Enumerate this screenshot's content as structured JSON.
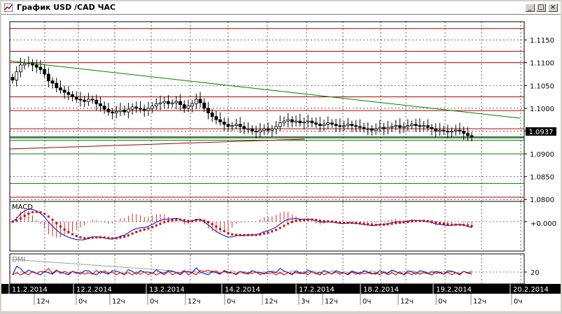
{
  "window": {
    "title": "График USD /CAD  ЧАС",
    "buttons": [
      "_",
      "□",
      "×"
    ]
  },
  "price_axis": {
    "labels": [
      "1.1150",
      "1.1100",
      "1.1050",
      "1.1000",
      "1.0950",
      "1.0900",
      "1.0850",
      "1.0800"
    ],
    "current_price": "1.0937"
  },
  "macd": {
    "label": "MACD",
    "zero_label": "+0.000"
  },
  "dmi": {
    "label": "DMI",
    "level_label": "20"
  },
  "dates": [
    "11.2.2014",
    "12.2.2014",
    "13.2.2014",
    "14.2.2014",
    "17.2.2014",
    "18.2.2014",
    "19.2.2014",
    "20.2.2014"
  ],
  "hour_labels": [
    "12ч",
    "0ч",
    "12ч",
    "0ч",
    "12ч",
    "0ч",
    "12ч",
    "3ч",
    "12ч",
    "0ч",
    "12ч",
    "0ч",
    "12ч",
    "0ч"
  ],
  "colors": {
    "hline": "#b00000",
    "trend_down": "#008000",
    "trend_up": "#a00000",
    "support": "#008000",
    "macd_line": "#0000c0",
    "macd_signal": "#d00000",
    "macd_hist": "#d00000",
    "dmi_plus": "#0000c0",
    "dmi_minus": "#d00000",
    "adx": "#a0a0a0"
  },
  "chart_data": {
    "type": "candlestick",
    "timeframe": "hourly",
    "instrument": "USD/CAD",
    "ylim": [
      1.0785,
      1.119
    ],
    "dates": [
      "11.2.2014",
      "12.2.2014",
      "13.2.2014",
      "14.2.2014",
      "17.2.2014",
      "18.2.2014",
      "19.2.2014",
      "20.2.2014"
    ],
    "close_profile": [
      1.1062,
      1.108,
      1.1095,
      1.1098,
      1.11,
      1.1095,
      1.109,
      1.1085,
      1.1075,
      1.106,
      1.1055,
      1.1045,
      1.104,
      1.1035,
      1.103,
      1.1025,
      1.102,
      1.1018,
      1.1015,
      1.102,
      1.1018,
      1.101,
      1.1005,
      1.0998,
      1.0992,
      1.099,
      1.0993,
      1.0996,
      1.0992,
      1.0998,
      1.1003,
      1.1,
      1.0998,
      1.0995,
      1.1,
      1.1005,
      1.101,
      1.1012,
      1.1015,
      1.101,
      1.1012,
      1.1015,
      1.1008,
      1.1,
      1.1005,
      1.101,
      1.102,
      1.1012,
      1.1,
      1.099,
      1.0982,
      1.0975,
      1.097,
      1.0965,
      1.096,
      1.0962,
      1.0965,
      1.096,
      1.0955,
      1.0955,
      1.095,
      1.0948,
      1.0952,
      1.0955,
      1.0952,
      1.0955,
      1.096,
      1.0968,
      1.0972,
      1.0975,
      1.097,
      1.0972,
      1.0968,
      1.097,
      1.0972,
      1.0968,
      1.0965,
      1.0962,
      1.0965,
      1.0968,
      1.0965,
      1.0962,
      1.096,
      1.0962,
      1.0965,
      1.0962,
      1.096,
      1.0958,
      1.0955,
      1.0955,
      1.0952,
      1.0955,
      1.0958,
      1.0955,
      1.0958,
      1.096,
      1.0962,
      1.0958,
      1.096,
      1.0962,
      1.0965,
      1.0962,
      1.096,
      1.0962,
      1.0958,
      1.0955,
      1.095,
      1.0952,
      1.095,
      1.0948,
      1.095,
      1.0952,
      1.095,
      1.0945,
      1.094,
      1.0937
    ],
    "horizontal_levels_red": [
      1.1175,
      1.1125,
      1.11,
      1.1025,
      1.0995,
      1.0955,
      1.0805
    ],
    "horizontal_levels_green": [
      1.0935,
      1.093,
      1.09,
      1.0835
    ],
    "current_price": 1.0937,
    "macd_zero": 0.0,
    "dmi_level": 20
  }
}
